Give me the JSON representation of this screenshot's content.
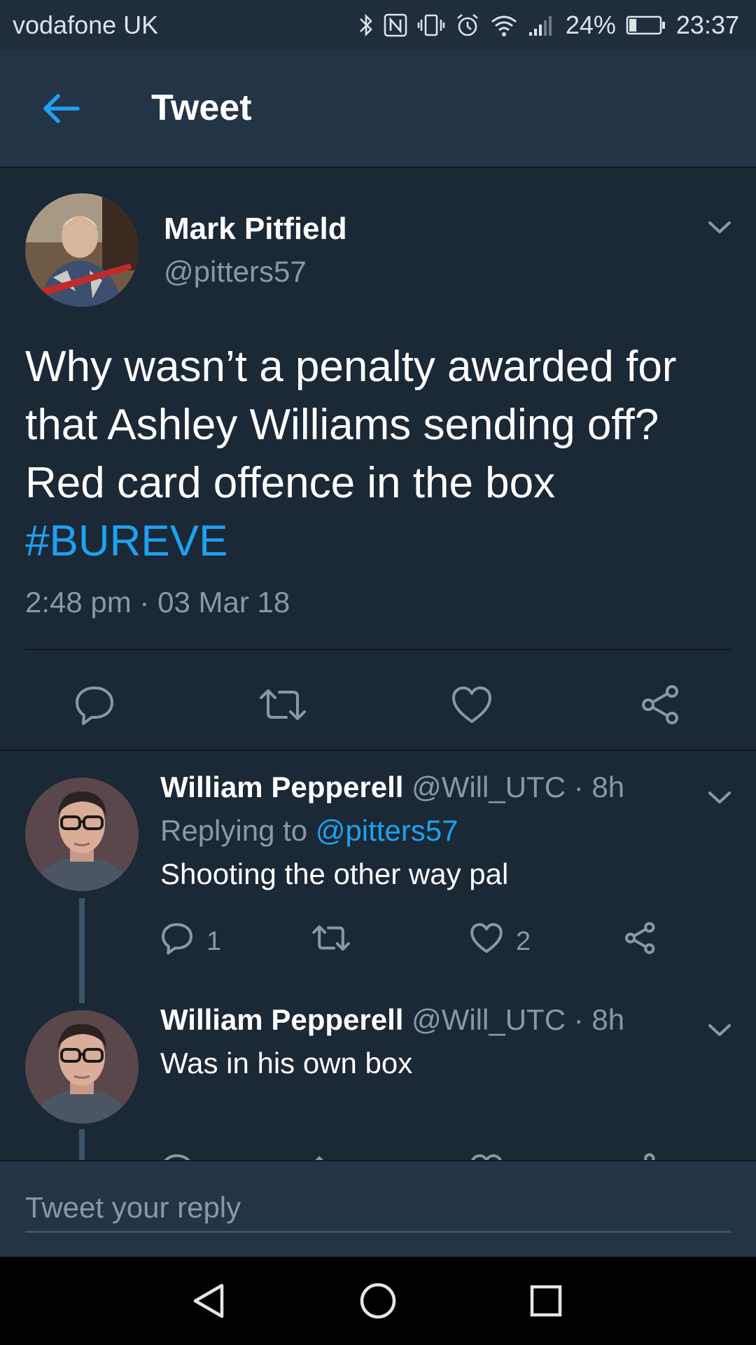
{
  "status_bar": {
    "carrier": "vodafone UK",
    "battery": "24%",
    "battery_level": 0.24,
    "time": "23:37"
  },
  "header": {
    "title": "Tweet",
    "back_icon": "arrow-left-icon"
  },
  "main_tweet": {
    "author_name": "Mark Pitfield",
    "author_handle": "@pitters57",
    "text": "Why wasn’t a penalty awarded for that Ashley Williams sending off? Red card offence in the box ",
    "hashtag": "#BUREVE",
    "timestamp": "2:48 pm · 03 Mar 18",
    "actions": [
      "reply-icon",
      "retweet-icon",
      "like-icon",
      "share-icon"
    ]
  },
  "replies": [
    {
      "author_name": "William Pepperell",
      "meta": " @Will_UTC · 8h",
      "replying_prefix": "Replying to ",
      "replying_mention": "@pitters57",
      "text": "Shooting the other way pal",
      "reply_count": "1",
      "like_count": "2"
    },
    {
      "author_name": "William Pepperell",
      "meta": " @Will_UTC · 8h",
      "text": "Was in his own box"
    }
  ],
  "composer": {
    "placeholder": "Tweet your reply"
  },
  "colors": {
    "background": "#1b2836",
    "header": "#243447",
    "accent": "#1da1f2",
    "muted": "#8899a6"
  }
}
